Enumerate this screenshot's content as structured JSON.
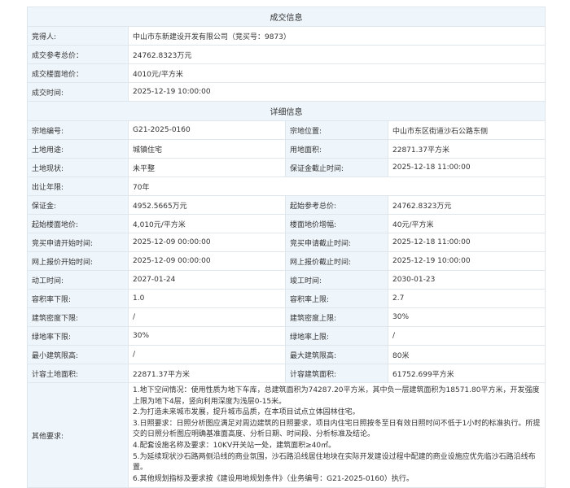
{
  "deal": {
    "title": "成交信息",
    "rows": [
      {
        "label": "竞得人:",
        "value": "中山市东新建设开发有限公司（竞买号：9873）"
      },
      {
        "label": "成交参考总价：",
        "value": "24762.8323万元"
      },
      {
        "label": "成交楼面地价：",
        "value": "4010元/平方米"
      },
      {
        "label": "成交时间:",
        "value": "2025-12-19 10:00:00"
      }
    ]
  },
  "detail": {
    "title": "详细信息",
    "rows": [
      [
        "宗地编号:",
        "G21-2025-0160",
        "宗地位置:",
        "中山市东区街道沙石公路东侧"
      ],
      [
        "土地用途:",
        "城镇住宅",
        "用地面积:",
        "22871.37平方米"
      ],
      [
        "土地现状:",
        "未平整",
        "保证金截止时间:",
        "2025-12-18 11:00:00"
      ],
      [
        "出让年限:",
        "70年"
      ],
      [
        "保证金:",
        "4952.5665万元",
        "起始参考总价:",
        "24762.8323万元"
      ],
      [
        "起始楼面地价:",
        "4,010元/平方米",
        "楼面地价增幅:",
        "40元/平方米"
      ],
      [
        "竞买申请开始时间:",
        "2025-12-09 00:00:00",
        "竞买申请截止时间:",
        "2025-12-18 11:00:00"
      ],
      [
        "网上报价开始时间:",
        "2025-12-09 00:00:00",
        "网上报价截止时间:",
        "2025-12-19 10:00:00"
      ],
      [
        "动工时间:",
        "2027-01-24",
        "竣工时间:",
        "2030-01-23"
      ],
      [
        "容积率下限:",
        "1.0",
        "容积率上限:",
        "2.7"
      ],
      [
        "建筑密度下限:",
        "/",
        "建筑密度上限:",
        "30%"
      ],
      [
        "绿地率下限:",
        "30%",
        "绿地率上限:",
        "/"
      ],
      [
        "最小建筑限高:",
        "/",
        "最大建筑限高:",
        "80米"
      ],
      [
        "计容土地面积:",
        "22871.37平方米",
        "计容建筑面积:",
        "61752.699平方米"
      ]
    ],
    "other_label": "其他要求:",
    "other_lines": [
      "1.地下空间情况：使用性质为地下车库，总建筑面积为74287.20平方米，其中负一层建筑面积为18571.80平方米，开发强度上限为地下4层，竖向利用深度为浅层0-15米。",
      "2.为打造未来城市发展，提升城市品质，在本项目试点立体园林住宅。",
      "3.日照要求：日照分析图应满足对周边建筑的日照要求，项目内住宅日照按冬至日有效日照时间不低于1小时的标准执行。所提交的日照分析图应明确基准面高度、分析日期、时间段、分析标准及结论。",
      "4.配套设施名称及要求：10KV开关站一处，建筑面积≥40㎡。",
      "5.为延续现状沙石路两侧沿线的商业氛围，沙石路沿线居住地块在实际开发建设过程中配建的商业设施应优先临沙石路沿线布置。",
      "6.其他规划指标及要求按《建设用地规划条件》（业务编号：G21-2025-0160）执行。"
    ]
  }
}
